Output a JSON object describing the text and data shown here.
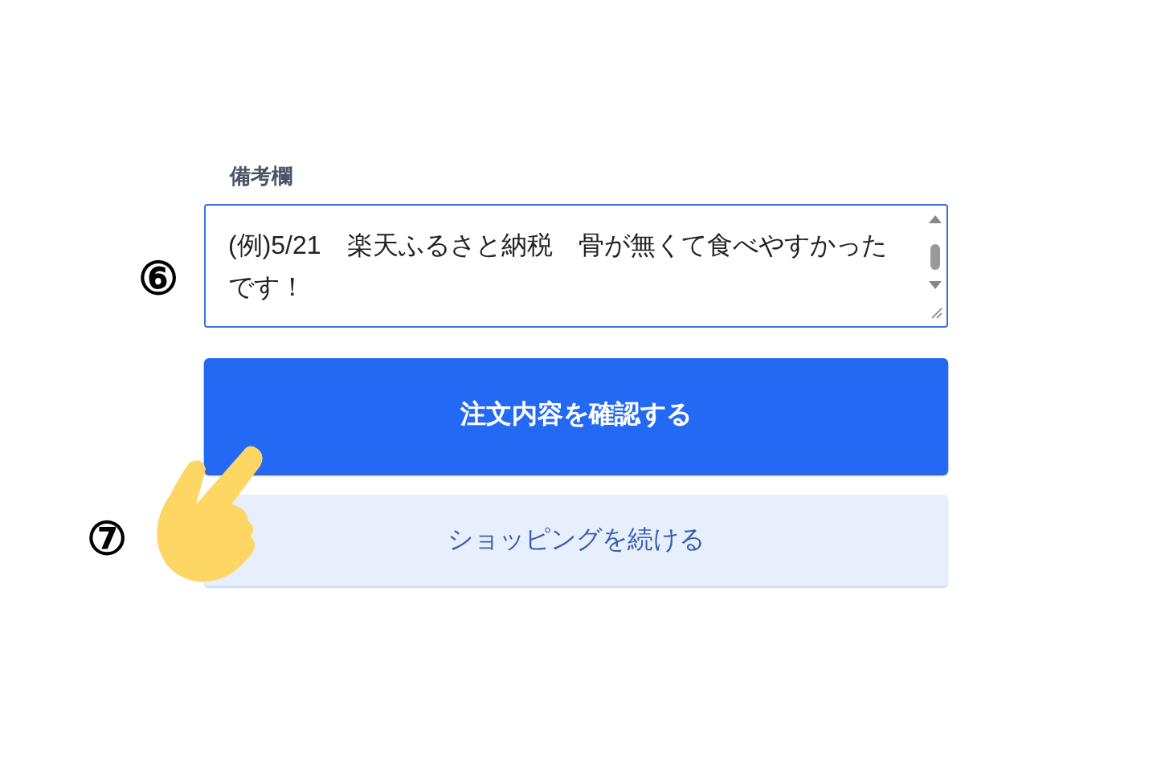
{
  "remarks": {
    "label": "備考欄",
    "marker": "⑥",
    "value": "(例)5/21　楽天ふるさと納税　骨が無くて食べやすかったです！"
  },
  "buttons": [
    {
      "kind": "primary",
      "label": "注文内容を確認する"
    },
    {
      "kind": "secondary",
      "label": "ショッピングを続ける",
      "marker": "⑦"
    }
  ]
}
